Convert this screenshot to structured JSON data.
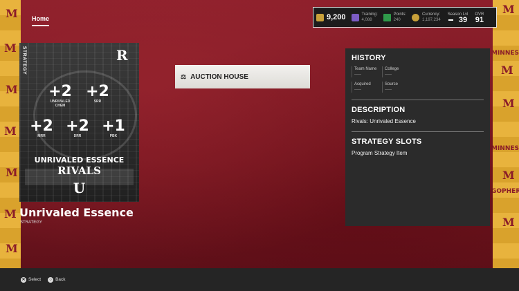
{
  "nav": {
    "home_label": "Home"
  },
  "stats": {
    "trophies": "9,200",
    "training_label": "Training:",
    "training_value": "4,088",
    "points_label": "Points:",
    "points_value": "240",
    "currency_label": "Currency:",
    "currency_value": "1,197,234",
    "season_label": "Season Lvl",
    "season_value": "39",
    "ovr_label": "OVR",
    "ovr_value": "91",
    "colors": {
      "trophy": "#c9a13a",
      "training": "#7c5cc4",
      "points": "#2f9a4a",
      "currency": "#c9a13a"
    }
  },
  "card": {
    "strategy_label": "STRATEGY",
    "logo": "R",
    "boosts": [
      {
        "value": "+2",
        "label": "UNRIVALED\nCHEM"
      },
      {
        "value": "+2",
        "label": "SRR"
      },
      {
        "value": "+2",
        "label": "MRR"
      },
      {
        "value": "+2",
        "label": "DRR"
      },
      {
        "value": "+1",
        "label": "PBK"
      }
    ],
    "title_line1": "UNRIVALED ESSENCE",
    "title_line2": "RIVALS",
    "team_logo": "U"
  },
  "item": {
    "name": "Unrivaled Essence",
    "type": "STRATEGY"
  },
  "auction": {
    "label": "AUCTION HOUSE",
    "icon": "gavel-icon"
  },
  "panel": {
    "history_title": "HISTORY",
    "history": [
      {
        "label": "Team Name",
        "value": "-----"
      },
      {
        "label": "College",
        "value": "-----"
      },
      {
        "label": "Acquired",
        "value": "-----"
      },
      {
        "label": "Source",
        "value": "-----"
      }
    ],
    "description_title": "DESCRIPTION",
    "description_text": "Rivals: Unrivaled Essence",
    "slots_title": "STRATEGY SLOTS",
    "slots_text": "Program Strategy Item"
  },
  "footer": {
    "select_label": "Select",
    "back_label": "Back"
  }
}
